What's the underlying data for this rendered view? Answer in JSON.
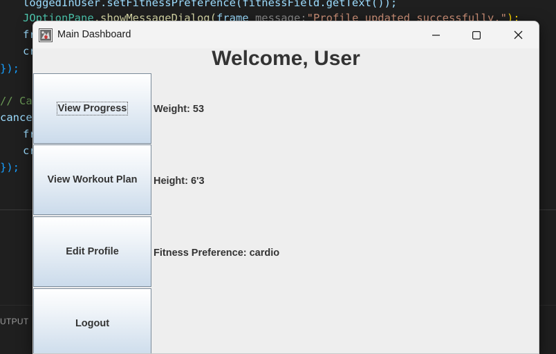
{
  "editor": {
    "line1": "loggedInUser.setFitnessPreference(fitnessField.getText());",
    "line2_cls": "JOptionPane",
    "line2_fn": ".showMessageDialog(",
    "line2_var": "frame",
    "line2_hint": " message:",
    "line2_str": "\"Profile updated successfully.\"",
    "line2_end": ");",
    "line3": "fr",
    "line4": "cr",
    "line5": "});",
    "line6": "// Ca",
    "line7": "cancel",
    "line8": "fr",
    "line9": "cr",
    "line10": "});"
  },
  "panel": {
    "output_tab": "UTPUT"
  },
  "window": {
    "title": "Main Dashboard",
    "heading": "Welcome, User",
    "buttons": [
      {
        "label": "View Progress"
      },
      {
        "label": "View Workout Plan"
      },
      {
        "label": "Edit Profile"
      },
      {
        "label": "Logout"
      }
    ],
    "info": {
      "weight": "Weight: 53",
      "height": "Height: 6'3",
      "fitness_preference": "Fitness Preference: cardio"
    }
  },
  "icons": {
    "minimize": "minimize-icon",
    "maximize": "maximize-icon",
    "close": "close-icon",
    "app": "java-app-icon"
  }
}
